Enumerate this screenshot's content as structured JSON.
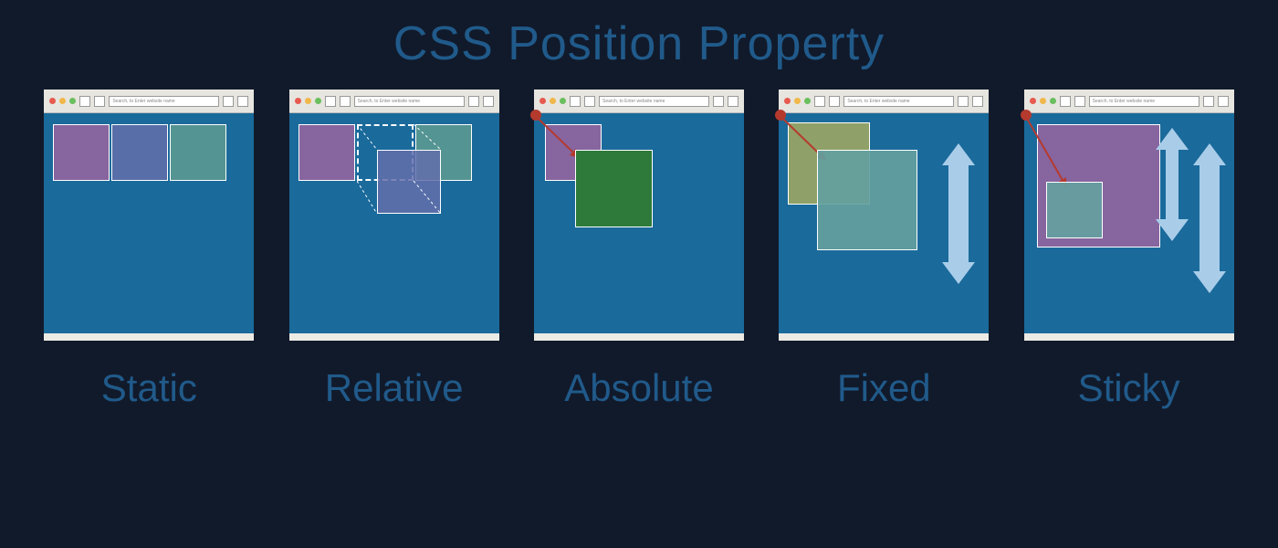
{
  "title": "CSS Position  Property",
  "url_placeholder": "Search, to Enter website name",
  "cards": [
    {
      "label": "Static"
    },
    {
      "label": "Relative"
    },
    {
      "label": "Absolute"
    },
    {
      "label": "Fixed"
    },
    {
      "label": "Sticky"
    }
  ],
  "colors": {
    "background": "#111a2b",
    "accent_text": "#205a8a",
    "viewport": "#1a6a9b",
    "arrow": "#a9cde9",
    "pin": "#b53a2e"
  }
}
